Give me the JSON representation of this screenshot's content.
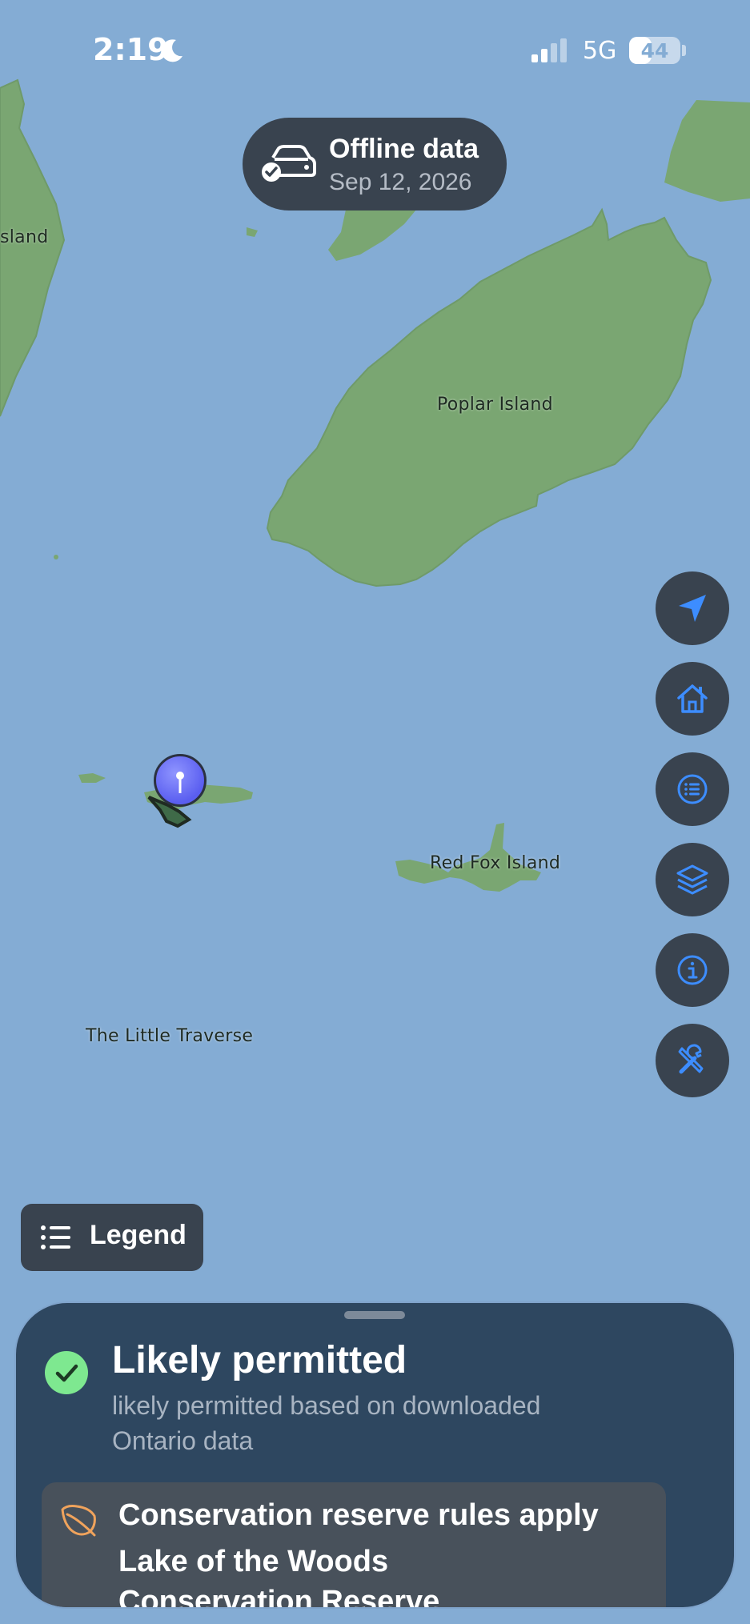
{
  "status_bar": {
    "time": "2:19",
    "network": "5G",
    "battery": "44",
    "battery_level": 0.44
  },
  "offline": {
    "title": "Offline data",
    "date": "Sep 12, 2026"
  },
  "map": {
    "labels": {
      "left_island": "sland",
      "poplar": "Poplar Island",
      "red_fox": "Red Fox Island",
      "little_traverse": "The Little Traverse"
    },
    "water_color": "#84acd4",
    "land_color": "#7aa672"
  },
  "controls": [
    "location-icon",
    "home-icon",
    "list-icon",
    "layers-icon",
    "info-icon",
    "tools-icon"
  ],
  "legend": {
    "label": "Legend"
  },
  "sheet": {
    "status_title": "Likely permitted",
    "status_desc": "likely permitted based on downloaded Ontario data",
    "rule_title": "Conservation reserve rules apply",
    "rule_sub": "Lake of the Woods Conservation Reserve"
  },
  "colors": {
    "accent": "#3d8dff",
    "panel": "#39434f",
    "ok": "#7ee890",
    "leaf": "#f0a35c"
  }
}
